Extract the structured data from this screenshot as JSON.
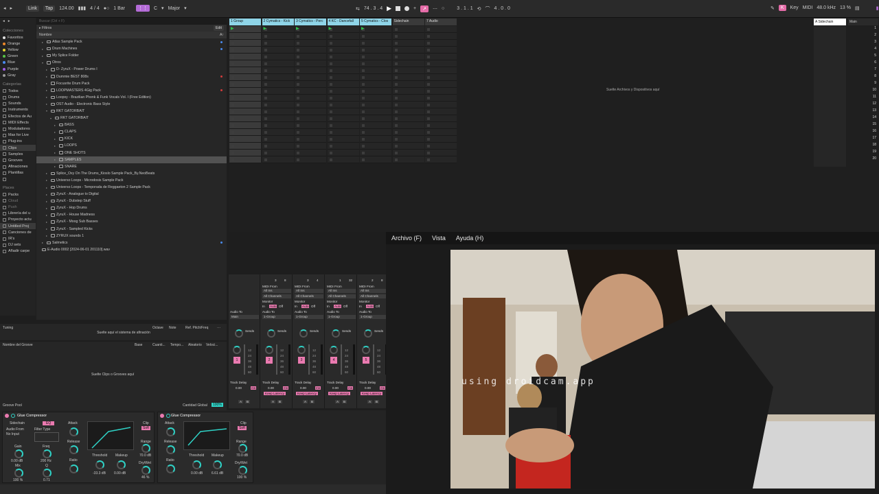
{
  "topbar": {
    "link": "Link",
    "tap": "Tap",
    "tempo": "124.00",
    "signature": "4 / 4",
    "quantize": "1 Bar",
    "key": "C",
    "scale": "Major",
    "position": "74 . 3 . 4",
    "loop_start": "3 . 1 . 1",
    "loop_length": "4 . 0 . 0",
    "key_label": "Key",
    "midi_label": "MIDI",
    "sample_rate": "48.0 kHz",
    "cpu": "13 %"
  },
  "sidebar": {
    "collections_title": "Colecciones",
    "collections": [
      {
        "label": "Favoritos",
        "color": "#e0e0e0"
      },
      {
        "label": "Orange",
        "color": "#f08a2a"
      },
      {
        "label": "Yellow",
        "color": "#e6d62e"
      },
      {
        "label": "Green",
        "color": "#58c447"
      },
      {
        "label": "Blue",
        "color": "#4a8cf0"
      },
      {
        "label": "Purple",
        "color": "#a05ce6"
      },
      {
        "label": "Gray",
        "color": "#9a9a9a"
      }
    ],
    "categories_title": "Categorías",
    "categories": [
      "Todos",
      "Drums",
      "Sounds",
      "Instruments",
      "Efectos de Au",
      "MIDI Effects",
      "Moduladores",
      "Max for Live",
      "Plug-ins",
      "Clips",
      "Samples",
      "Grooves",
      "Afinaciones",
      "Plantillas"
    ],
    "places_title": "Places",
    "places": [
      "Packs",
      "Cloud",
      "Push",
      "Librería del u",
      "Proyecto actu",
      "Untitled Proj",
      "Canciones de",
      "IR's",
      "DJ sets",
      "Añadir carpe"
    ]
  },
  "browser": {
    "search_placeholder": "Buscar (Ctrl + F)",
    "filters": "Filtros",
    "edit": "Edit",
    "column_name": "Nombre",
    "sort": "A↑",
    "rows": [
      {
        "label": "Atlas Sample Pack",
        "indent": 1,
        "dot": "#4a8cf0"
      },
      {
        "label": "Drum Machines",
        "indent": 1,
        "dot": "#4a8cf0"
      },
      {
        "label": "My Splice Folder",
        "indent": 1,
        "dot": ""
      },
      {
        "label": "Otros",
        "indent": 1,
        "dot": "",
        "open": true
      },
      {
        "label": "D- ZyruX - Power Drums I",
        "indent": 2,
        "dot": ""
      },
      {
        "label": "Dummie BEST 808s",
        "indent": 2,
        "dot": "#d23b3b"
      },
      {
        "label": "Focusrite  Drum  Pack",
        "indent": 2,
        "dot": ""
      },
      {
        "label": "LOOPMASTERS 4Gig Pack",
        "indent": 2,
        "dot": "#d23b3b"
      },
      {
        "label": "Loopsy - Brazilian Phonk & Funk Vocals Vol. I (Free Edition)",
        "indent": 2,
        "dot": ""
      },
      {
        "label": "OST Audio - Electronic Bass Style",
        "indent": 2,
        "dot": ""
      },
      {
        "label": "RKT GATORBAIT",
        "indent": 2,
        "dot": "",
        "open": true
      },
      {
        "label": "RKT GATORBAIT",
        "indent": 3,
        "dot": "",
        "open": true
      },
      {
        "label": "BASS",
        "indent": 4,
        "dot": ""
      },
      {
        "label": "CLAPS",
        "indent": 4,
        "dot": ""
      },
      {
        "label": "KICK",
        "indent": 4,
        "dot": ""
      },
      {
        "label": "LOOPS",
        "indent": 4,
        "dot": ""
      },
      {
        "label": "ONE SHOTS",
        "indent": 4,
        "dot": ""
      },
      {
        "label": "SAMPLES",
        "indent": 4,
        "dot": "",
        "selected": true
      },
      {
        "label": "SNARE",
        "indent": 4,
        "dot": ""
      },
      {
        "label": "Splice_Oxy On The Drums_Kioslo Sample Pack_By.NeoBeats",
        "indent": 2,
        "dot": ""
      },
      {
        "label": "Universo Loops - Microdosis Sample Pack",
        "indent": 2,
        "dot": ""
      },
      {
        "label": "Universo Loops - Temporada de Reggaeton 2 Sample Pack",
        "indent": 2,
        "dot": ""
      },
      {
        "label": "ZyruX - Analogue to Digital",
        "indent": 2,
        "dot": ""
      },
      {
        "label": "ZyruX - Dubstep Stuff",
        "indent": 2,
        "dot": ""
      },
      {
        "label": "ZyruX - Hop Drums",
        "indent": 2,
        "dot": ""
      },
      {
        "label": "ZyruX - House Madness",
        "indent": 2,
        "dot": ""
      },
      {
        "label": "ZyruX - Moog Sub Basses",
        "indent": 2,
        "dot": ""
      },
      {
        "label": "ZyruX - Sampled Kicks",
        "indent": 2,
        "dot": ""
      },
      {
        "label": "ZYRUX sounds 1",
        "indent": 2,
        "dot": ""
      },
      {
        "label": "Salmetics",
        "indent": 1,
        "dot": "#4a8cf0"
      },
      {
        "label": "E-Audio 0002 [2024-06-01 201110].wav",
        "indent": 1,
        "dot": "",
        "file": true
      }
    ]
  },
  "tuning": {
    "title": "Tuning",
    "drop_text": "Suelte aquí el sistema de afinación",
    "cols": [
      "Octave",
      "Note",
      "Ref. Pitch/Freq"
    ]
  },
  "groove": {
    "cols": [
      "Nombre del Groove",
      "Base",
      "Cuanti...",
      "Tempo...",
      "Aleatorio",
      "Veloci..."
    ],
    "drop_text": "Suelte Clips o Grooves aquí",
    "pool": "Groove Pool",
    "global_label": "Cantidad Global",
    "global_value": "100%"
  },
  "session": {
    "tracks": [
      {
        "name": "1 Group",
        "color": "#8fd5e8"
      },
      {
        "name": "2 Cymatics - Kick",
        "color": "#8fd5e8"
      },
      {
        "name": "3 Cymatics - Perc",
        "color": "#8fd5e8"
      },
      {
        "name": "4 KC - Dancefall",
        "color": "#8fd5e8"
      },
      {
        "name": "5 Cymatics - Clos",
        "color": "#8fd5e8"
      },
      {
        "name": "Sidechain",
        "color": "#3a3a3a"
      },
      {
        "name": "7 Audio",
        "color": "#3a3a3a"
      }
    ],
    "drop_text": "Suelte Archivos y Dispositivos aquí",
    "return_track": "A Sidechain",
    "main_track": "Main",
    "scenes": [
      "1",
      "2",
      "3",
      "4",
      "5",
      "6",
      "7",
      "8",
      "9",
      "10",
      "11",
      "12",
      "13",
      "14",
      "15",
      "16",
      "17",
      "18",
      "19",
      "20"
    ]
  },
  "mixer": {
    "group_audio_to": "Audio To",
    "group_audio_to_value": "Main",
    "midi_from": "MIDI From",
    "all_ins": "All Ins",
    "all_channels": "All Channels",
    "monitor": "Monitor",
    "monitor_in": "In",
    "monitor_auto": "Auto",
    "monitor_off": "Off",
    "audio_to": "Audio To",
    "audio_to_value": "1-Group",
    "sends": "Sends",
    "track_delay": "Track Delay",
    "delay_value": "0.00",
    "delay_unit": "ms",
    "keep_latency": "Keep Latency",
    "a": "A",
    "b": "B",
    "channels": [
      {
        "num": "1",
        "top": [
          "",
          ""
        ]
      },
      {
        "num": "2",
        "top": [
          "3",
          "8"
        ]
      },
      {
        "num": "3",
        "top": [
          "3",
          "4"
        ]
      },
      {
        "num": "4",
        "top": [
          "1",
          "32"
        ]
      },
      {
        "num": "5",
        "top": [
          "2",
          "8"
        ]
      }
    ],
    "fader_vals": [
      "12",
      "24",
      "36",
      "48",
      "60"
    ]
  },
  "devices": {
    "glue1": {
      "title": "Glue Compressor",
      "sidechain": "Sidechain",
      "eq": "EQ",
      "audio_from": "Audio From",
      "no_input": "No Input",
      "filter_type": "Filter Type",
      "gain": "Gain",
      "gain_val": "0.00 dB",
      "freq": "Freq",
      "freq_val": "200 Hz",
      "mix": "Mix",
      "mix_val": "100 %",
      "q": "Q",
      "q_val": "0.71",
      "attack": "Attack",
      "release": "Release",
      "ratio": "Ratio",
      "threshold": "Threshold",
      "threshold_val": "-33.3 dB",
      "makeup": "Makeup",
      "makeup_val": "0.00 dB",
      "clip": "Clip",
      "soft": "Soft",
      "range": "Range",
      "range_val": "70.0 dB",
      "drywet": "Dry/Wet",
      "drywet_val": "46 %"
    },
    "glue2": {
      "title": "Glue Compressor",
      "attack": "Attack",
      "release": "Release",
      "ratio": "Ratio",
      "threshold": "Threshold",
      "threshold_val": "0.00 dB",
      "makeup": "Makeup",
      "makeup_val": "6.61 dB",
      "clip": "Clip",
      "soft": "Soft",
      "range": "Range",
      "range_val": "70.0 dB",
      "drywet": "Dry/Wet",
      "drywet_val": "100 %"
    }
  },
  "camera": {
    "menu": [
      "Archivo (F)",
      "Vista",
      "Ayuda (H)"
    ],
    "watermark": "using droidcam.app"
  }
}
